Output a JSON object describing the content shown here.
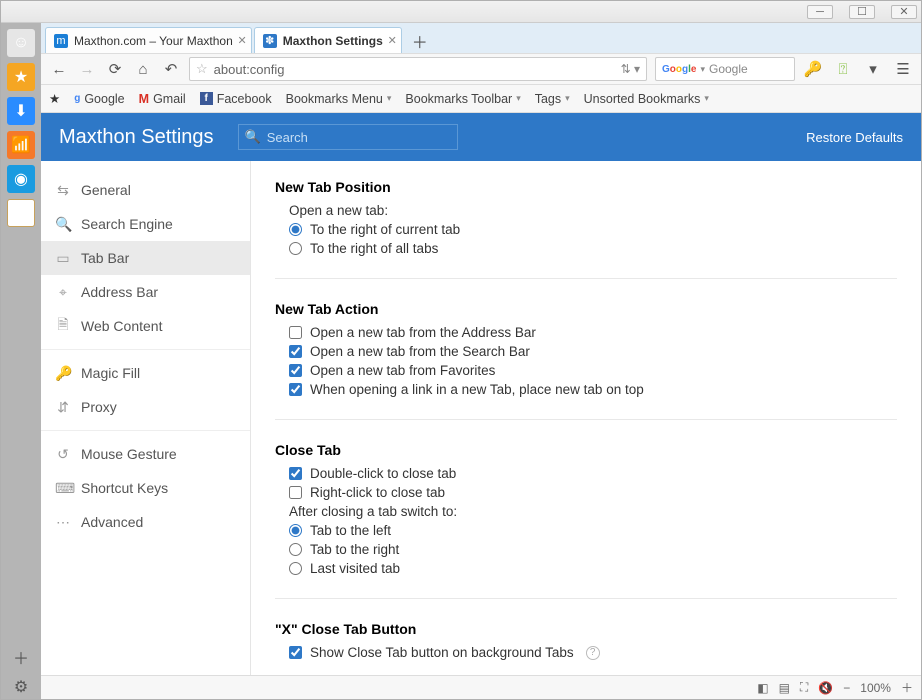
{
  "tabs": [
    {
      "label": "Maxthon.com – Your Maxthon"
    },
    {
      "label": "Maxthon Settings"
    }
  ],
  "address": {
    "value": "about:config",
    "security_icon": "☆"
  },
  "searchbox": {
    "placeholder": "Google"
  },
  "bookmarks": [
    "Google",
    "Gmail",
    "Facebook",
    "Bookmarks Menu",
    "Bookmarks Toolbar",
    "Tags",
    "Unsorted Bookmarks"
  ],
  "header": {
    "title": "Maxthon Settings",
    "search_ph": "Search",
    "restore": "Restore Defaults"
  },
  "sidebar": {
    "groups": [
      [
        {
          "icon": "⇆",
          "label": "General"
        },
        {
          "icon": "🔍",
          "label": "Search Engine"
        },
        {
          "icon": "▭",
          "label": "Tab Bar",
          "active": true
        },
        {
          "icon": "⌖",
          "label": "Address Bar"
        },
        {
          "icon": "🗎",
          "label": "Web Content"
        }
      ],
      [
        {
          "icon": "🔑",
          "label": "Magic Fill"
        },
        {
          "icon": "⇵",
          "label": "Proxy"
        }
      ],
      [
        {
          "icon": "↺",
          "label": "Mouse Gesture"
        },
        {
          "icon": "⌨",
          "label": "Shortcut Keys"
        },
        {
          "icon": "⋯",
          "label": "Advanced"
        }
      ]
    ]
  },
  "sections": {
    "newTabPosition": {
      "title": "New Tab Position",
      "sub": "Open a new tab:",
      "opts": [
        "To the right of current tab",
        "To the right of all tabs"
      ],
      "selected": 0
    },
    "newTabAction": {
      "title": "New Tab Action",
      "opts": [
        {
          "label": "Open a new tab from the Address Bar",
          "checked": false
        },
        {
          "label": "Open a new tab from the Search Bar",
          "checked": true
        },
        {
          "label": "Open a new tab from Favorites",
          "checked": true
        },
        {
          "label": "When opening a link in a new Tab, place new tab on top",
          "checked": true
        }
      ]
    },
    "closeTab": {
      "title": "Close Tab",
      "opts": [
        {
          "label": "Double-click to close tab",
          "checked": true
        },
        {
          "label": "Right-click to close tab",
          "checked": false
        }
      ],
      "sub": "After closing a tab switch to:",
      "radios": [
        "Tab to the left",
        "Tab to the right",
        "Last visited tab"
      ],
      "selected": 0
    },
    "xClose": {
      "title": "\"X\" Close Tab Button",
      "opt": {
        "label": "Show Close Tab button on background Tabs",
        "checked": true
      }
    }
  },
  "status": {
    "zoom": "100%"
  }
}
